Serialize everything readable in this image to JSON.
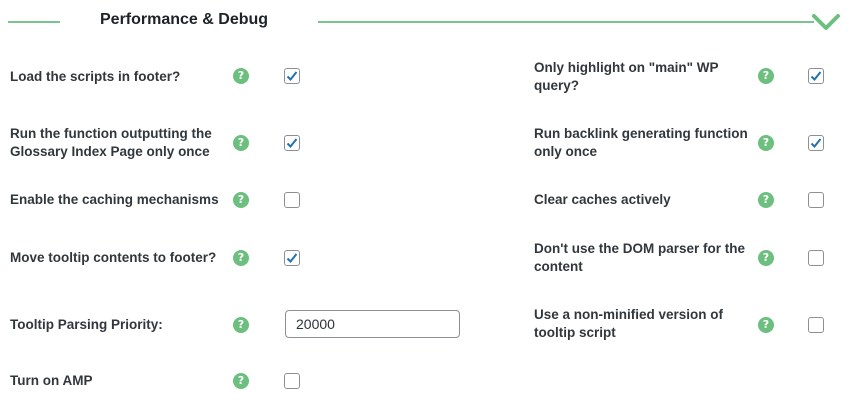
{
  "header": {
    "title": "Performance & Debug"
  },
  "priority_input": {
    "value": "20000"
  },
  "left_options": [
    {
      "label": "Load the scripts in footer?",
      "checked": true
    },
    {
      "label": "Run the function outputting the Glossary Index Page only once",
      "checked": true
    },
    {
      "label": "Enable the caching mechanisms",
      "checked": false
    },
    {
      "label": "Move tooltip contents to footer?",
      "checked": true
    },
    {
      "label": "Tooltip Parsing Priority:"
    },
    {
      "label": "Turn on AMP",
      "checked": false
    }
  ],
  "right_options": [
    {
      "label": "Only highlight on \"main\" WP query?",
      "checked": true
    },
    {
      "label": "Run backlink generating function only once",
      "checked": true
    },
    {
      "label": "Clear caches actively",
      "checked": false
    },
    {
      "label": "Don't use the DOM parser for the content",
      "checked": false
    },
    {
      "label": "Use a non-minified version of tooltip script",
      "checked": false
    }
  ],
  "help_glyph": "?",
  "colors": {
    "accent": "#7ac48f",
    "help": "#6dbf7f",
    "check": "#2271b1"
  },
  "icons": {
    "collapse": "chevron-down-icon",
    "help": "help-icon",
    "check": "checkmark-icon"
  }
}
